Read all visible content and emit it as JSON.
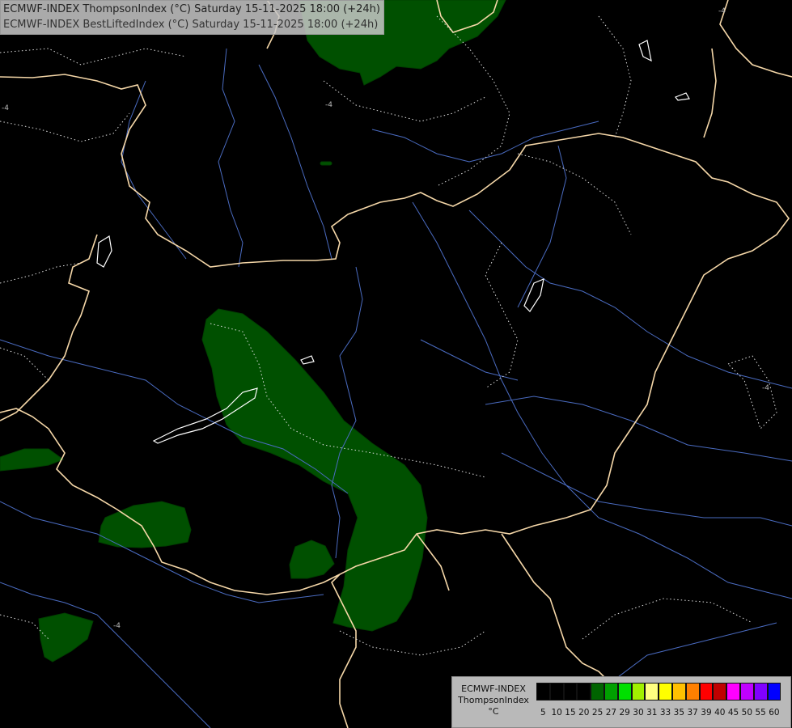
{
  "title": {
    "line1": "ECMWF-INDEX ThompsonIndex (°C) Saturday 15-11-2025 18:00 (+24h)",
    "line2": "ECMWF-INDEX BestLiftedIndex (°C) Saturday 15-11-2025 18:00 (+24h)"
  },
  "legend": {
    "model": "ECMWF-INDEX",
    "parameter": "ThompsonIndex",
    "unit": "°C",
    "classes": [
      {
        "label": "5",
        "color": "#000000"
      },
      {
        "label": "10",
        "color": "#000000"
      },
      {
        "label": "15",
        "color": "#000000"
      },
      {
        "label": "20",
        "color": "#000000"
      },
      {
        "label": "25",
        "color": "#006400"
      },
      {
        "label": "27",
        "color": "#00a000"
      },
      {
        "label": "29",
        "color": "#00e000"
      },
      {
        "label": "30",
        "color": "#a0f000"
      },
      {
        "label": "31",
        "color": "#ffff80"
      },
      {
        "label": "33",
        "color": "#ffff00"
      },
      {
        "label": "35",
        "color": "#ffc000"
      },
      {
        "label": "37",
        "color": "#ff8000"
      },
      {
        "label": "39",
        "color": "#ff0000"
      },
      {
        "label": "40",
        "color": "#c00000"
      },
      {
        "label": "45",
        "color": "#ff00ff"
      },
      {
        "label": "50",
        "color": "#c000ff"
      },
      {
        "label": "55",
        "color": "#8000ff"
      },
      {
        "label": "60",
        "color": "#0000ff"
      }
    ]
  },
  "map_colors": {
    "background": "#000000",
    "border": "#f5d7a8",
    "river": "#4a6bc0",
    "index_fill": "#005000",
    "lifted_contour": "#ffffff"
  }
}
